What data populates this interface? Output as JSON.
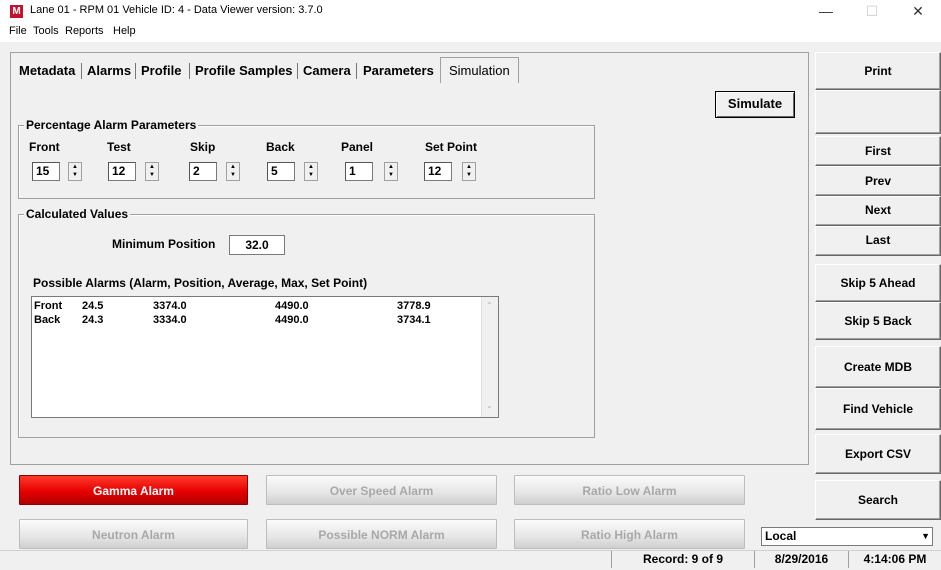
{
  "window": {
    "title": "Lane 01 - RPM 01  Vehicle ID: 4 - Data Viewer   version: 3.7.0",
    "icon_letter": "M",
    "controls": {
      "minimize": "—",
      "maximize": "☐",
      "close": "✕"
    }
  },
  "menu": [
    "File",
    "Tools",
    "Reports",
    "Help"
  ],
  "tabs": [
    "Metadata",
    "Alarms",
    "Profile",
    "Profile Samples",
    "Camera",
    "Parameters",
    "Simulation"
  ],
  "active_tab": "Simulation",
  "simulate_label": "Simulate",
  "percentage_group": {
    "legend": "Percentage Alarm Parameters",
    "params": [
      {
        "label": "Front",
        "value": "15"
      },
      {
        "label": "Test",
        "value": "12"
      },
      {
        "label": "Skip",
        "value": "2"
      },
      {
        "label": "Back",
        "value": "5"
      },
      {
        "label": "Panel",
        "value": "1"
      },
      {
        "label": "Set Point",
        "value": "12"
      }
    ]
  },
  "calculated_group": {
    "legend": "Calculated Values",
    "min_position_label": "Minimum Position",
    "min_position_value": "32.0",
    "possible_alarms_label": "Possible Alarms (Alarm, Position, Average, Max, Set Point)",
    "rows": [
      [
        "Front",
        "24.5",
        "3374.0",
        "4490.0",
        "3778.9"
      ],
      [
        "Back",
        "24.3",
        "3334.0",
        "4490.0",
        "3734.1"
      ]
    ]
  },
  "side_buttons": {
    "print": "Print",
    "first": "First",
    "prev": "Prev",
    "next": "Next",
    "last": "Last",
    "skip_ahead": "Skip 5 Ahead",
    "skip_back": "Skip 5 Back",
    "create_mdb": "Create MDB",
    "find_vehicle": "Find Vehicle",
    "export_csv": "Export CSV",
    "search": "Search"
  },
  "alarms": {
    "gamma": "Gamma Alarm",
    "over_speed": "Over Speed Alarm",
    "ratio_low": "Ratio Low Alarm",
    "neutron": "Neutron Alarm",
    "possible_norm": "Possible NORM Alarm",
    "ratio_high": "Ratio High Alarm"
  },
  "colors": {
    "alarm_active": "#e60000",
    "alarm_inactive_text": "#a8a8a8"
  },
  "location_select": {
    "value": "Local",
    "icon": "dropdown-arrow-icon"
  },
  "status": {
    "record": "Record: 9 of 9",
    "date": "8/29/2016",
    "time": "4:14:06 PM"
  }
}
